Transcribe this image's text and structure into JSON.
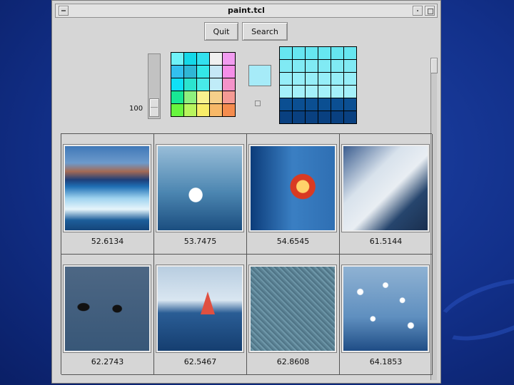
{
  "window": {
    "title": "paint.tcl"
  },
  "toolbar": {
    "quit_label": "Quit",
    "search_label": "Search"
  },
  "brightness": {
    "value": "100",
    "level": 0.0
  },
  "palette": {
    "colors": [
      "#6ff2f8",
      "#14d8e8",
      "#32e1ee",
      "#f0f0f0",
      "#f29cf0",
      "#33c0ee",
      "#2fb7d6",
      "#33e8e8",
      "#c6e8f6",
      "#f58fe8",
      "#10e0f6",
      "#2be4cf",
      "#48ebe8",
      "#c0ecf8",
      "#f493c9",
      "#18e894",
      "#8ef07e",
      "#f8f28f",
      "#f6d08a",
      "#f49a94",
      "#67f53e",
      "#b8f45e",
      "#f8ec68",
      "#f7b868",
      "#f48c4e"
    ]
  },
  "selected_color": "#a6ebf8",
  "shades": {
    "colors": [
      "#66e6f0",
      "#66e6f0",
      "#66e6f0",
      "#66e6f0",
      "#66e6f0",
      "#66e6f0",
      "#80eaf4",
      "#80eaf4",
      "#80eaf4",
      "#80eaf4",
      "#80eaf4",
      "#80eaf4",
      "#96eef8",
      "#96eef8",
      "#96eef8",
      "#96eef8",
      "#96eef8",
      "#96eef8",
      "#a4f0fa",
      "#a4f0fa",
      "#a4f0fa",
      "#a4f0fa",
      "#a4f0fa",
      "#a4f0fa",
      "#0b4f92",
      "#0b4f92",
      "#0b4f92",
      "#0b4f92",
      "#0b4f92",
      "#0b4f92",
      "#094080",
      "#094080",
      "#094080",
      "#094080",
      "#094080",
      "#094080"
    ]
  },
  "results": [
    {
      "subject": "iceberg",
      "score": "52.6134"
    },
    {
      "subject": "swan",
      "score": "53.7475"
    },
    {
      "subject": "apple",
      "score": "54.6545"
    },
    {
      "subject": "sailboat",
      "score": "61.5144"
    },
    {
      "subject": "ducks",
      "score": "62.2743"
    },
    {
      "subject": "windsurfers",
      "score": "62.5467"
    },
    {
      "subject": "texture",
      "score": "62.8608"
    },
    {
      "subject": "seagulls",
      "score": "64.1853"
    }
  ]
}
